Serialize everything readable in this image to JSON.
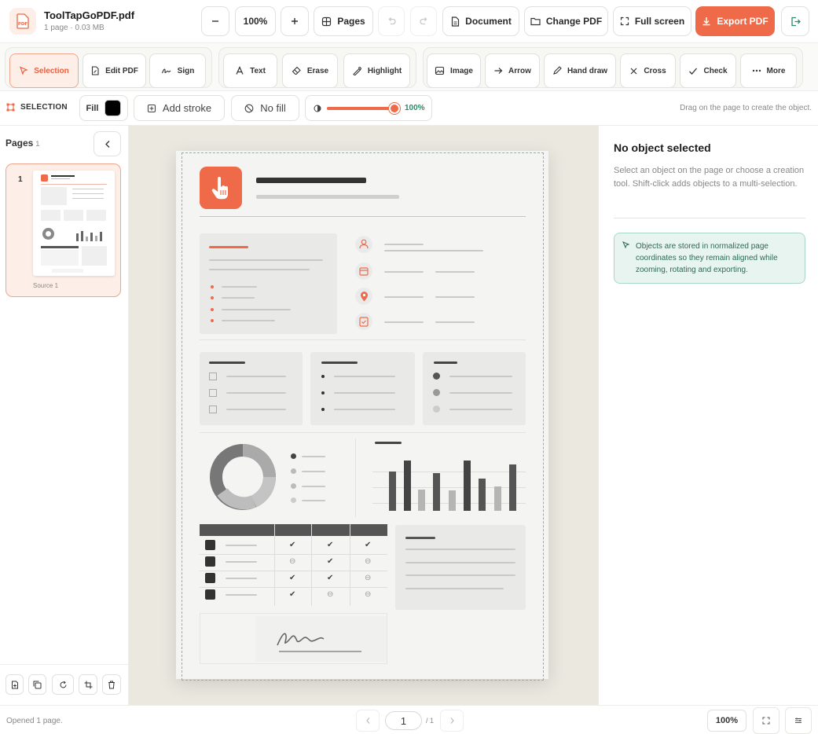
{
  "app": {
    "file_name": "ToolTapGoPDF.pdf",
    "file_meta": "1 page · 0.03 MB",
    "file_icon": "pdf-file-icon"
  },
  "topbar": {
    "zoom_out_icon": "minus-icon",
    "zoom_value": "100%",
    "zoom_in_icon": "plus-icon",
    "pages_label": "Pages",
    "undo_icon": "undo-icon",
    "redo_icon": "redo-icon",
    "document_label": "Document",
    "change_pdf_label": "Change PDF",
    "fullscreen_label": "Full screen",
    "export_label": "Export PDF",
    "exit_icon": "exit-icon"
  },
  "tools": {
    "selection": "Selection",
    "edit_pdf": "Edit PDF",
    "sign": "Sign",
    "text": "Text",
    "erase": "Erase",
    "highlight": "Highlight",
    "image": "Image",
    "arrow": "Arrow",
    "hand_draw": "Hand draw",
    "cross": "Cross",
    "check": "Check",
    "more": "More"
  },
  "selection_bar": {
    "title": "SELECTION",
    "fill_label": "Fill",
    "fill_color": "#000000",
    "add_stroke": "Add stroke",
    "no_fill": "No fill",
    "opacity_value": "100%",
    "opacity_fraction": 1.0,
    "hint": "Drag on the page to create the object."
  },
  "sidebar": {
    "title": "Pages",
    "count": "1",
    "thumbnails": [
      {
        "number": "1",
        "caption": "Source 1"
      }
    ],
    "footer_icons": [
      "add-page-icon",
      "duplicate-icon",
      "rotate-icon",
      "crop-icon",
      "delete-icon"
    ]
  },
  "properties": {
    "title": "No object selected",
    "description": "Select an object on the page or choose a creation tool. Shift-click adds objects to a multi-selection.",
    "info": "Objects are stored in normalized page coordinates so they remain aligned while zooming, rotating and exporting."
  },
  "statusbar": {
    "message": "Opened 1 page.",
    "page_input": "1",
    "page_total": "/ 1",
    "zoom": "100%"
  },
  "colors": {
    "accent": "#ee6a48",
    "accent_soft": "#fdeee8",
    "info_bg": "#e8f4ef",
    "info_border": "#a9d7c4",
    "info_text": "#2c6a55"
  }
}
